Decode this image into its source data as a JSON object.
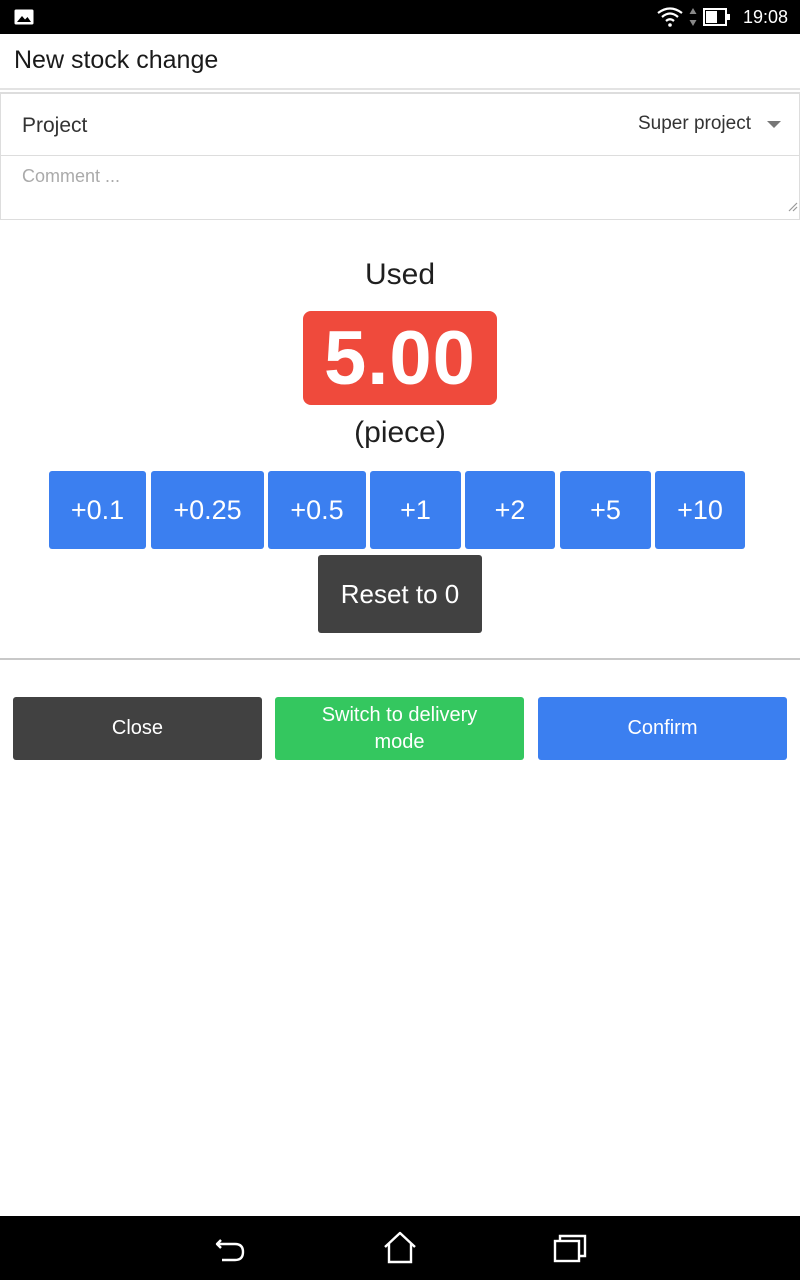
{
  "status_bar": {
    "time": "19:08",
    "icons": [
      "gallery-icon",
      "wifi-icon",
      "data-arrows-icon",
      "battery-icon"
    ]
  },
  "app_bar": {
    "title": "New stock change"
  },
  "form": {
    "project_label": "Project",
    "project_value": "Super project",
    "comment_placeholder": "Comment ..."
  },
  "counter": {
    "mode_label": "Used",
    "value": "5.00",
    "unit": "(piece)",
    "badge_color": "#ef4a3c"
  },
  "increments": [
    "+0.1",
    "+0.25",
    "+0.5",
    "+1",
    "+2",
    "+5",
    "+10"
  ],
  "reset_label": "Reset to 0",
  "actions": {
    "close": "Close",
    "switch": "Switch to delivery mode",
    "confirm": "Confirm"
  },
  "colors": {
    "primary": "#3b7ff0",
    "dark": "#414141",
    "success": "#34c75f",
    "danger": "#ef4a3c"
  },
  "nav_bar": {
    "icons": [
      "back-icon",
      "home-icon",
      "recents-icon"
    ]
  }
}
